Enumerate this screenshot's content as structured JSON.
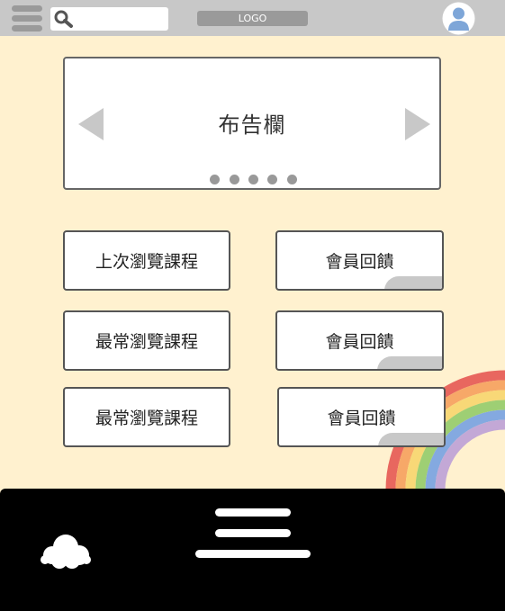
{
  "header": {
    "menu_icon": "hamburger-icon",
    "search": {
      "placeholder": "",
      "icon": "search-icon"
    },
    "logo_text": "LOGO",
    "avatar_icon": "user-avatar-icon"
  },
  "bulletin": {
    "title": "布告欄",
    "prev_icon": "arrow-left-icon",
    "next_icon": "arrow-right-icon",
    "dot_count": 5
  },
  "cards": [
    {
      "label": "上次瀏覽課程"
    },
    {
      "label": "會員回饋"
    },
    {
      "label": "最常瀏覽課程"
    },
    {
      "label": "會員回饋"
    },
    {
      "label": "最常瀏覽課程"
    },
    {
      "label": "會員回饋"
    }
  ],
  "footer": {
    "cloud_icon": "cloud-icon",
    "menu_icon": "footer-menu-icon"
  },
  "colors": {
    "background": "#fff1cf",
    "header": "#c8c8c8",
    "footer": "#000000",
    "rainbow": [
      "#e8675f",
      "#f7a868",
      "#f8d877",
      "#9ecf74",
      "#84a9e0",
      "#c3a8d6"
    ]
  }
}
